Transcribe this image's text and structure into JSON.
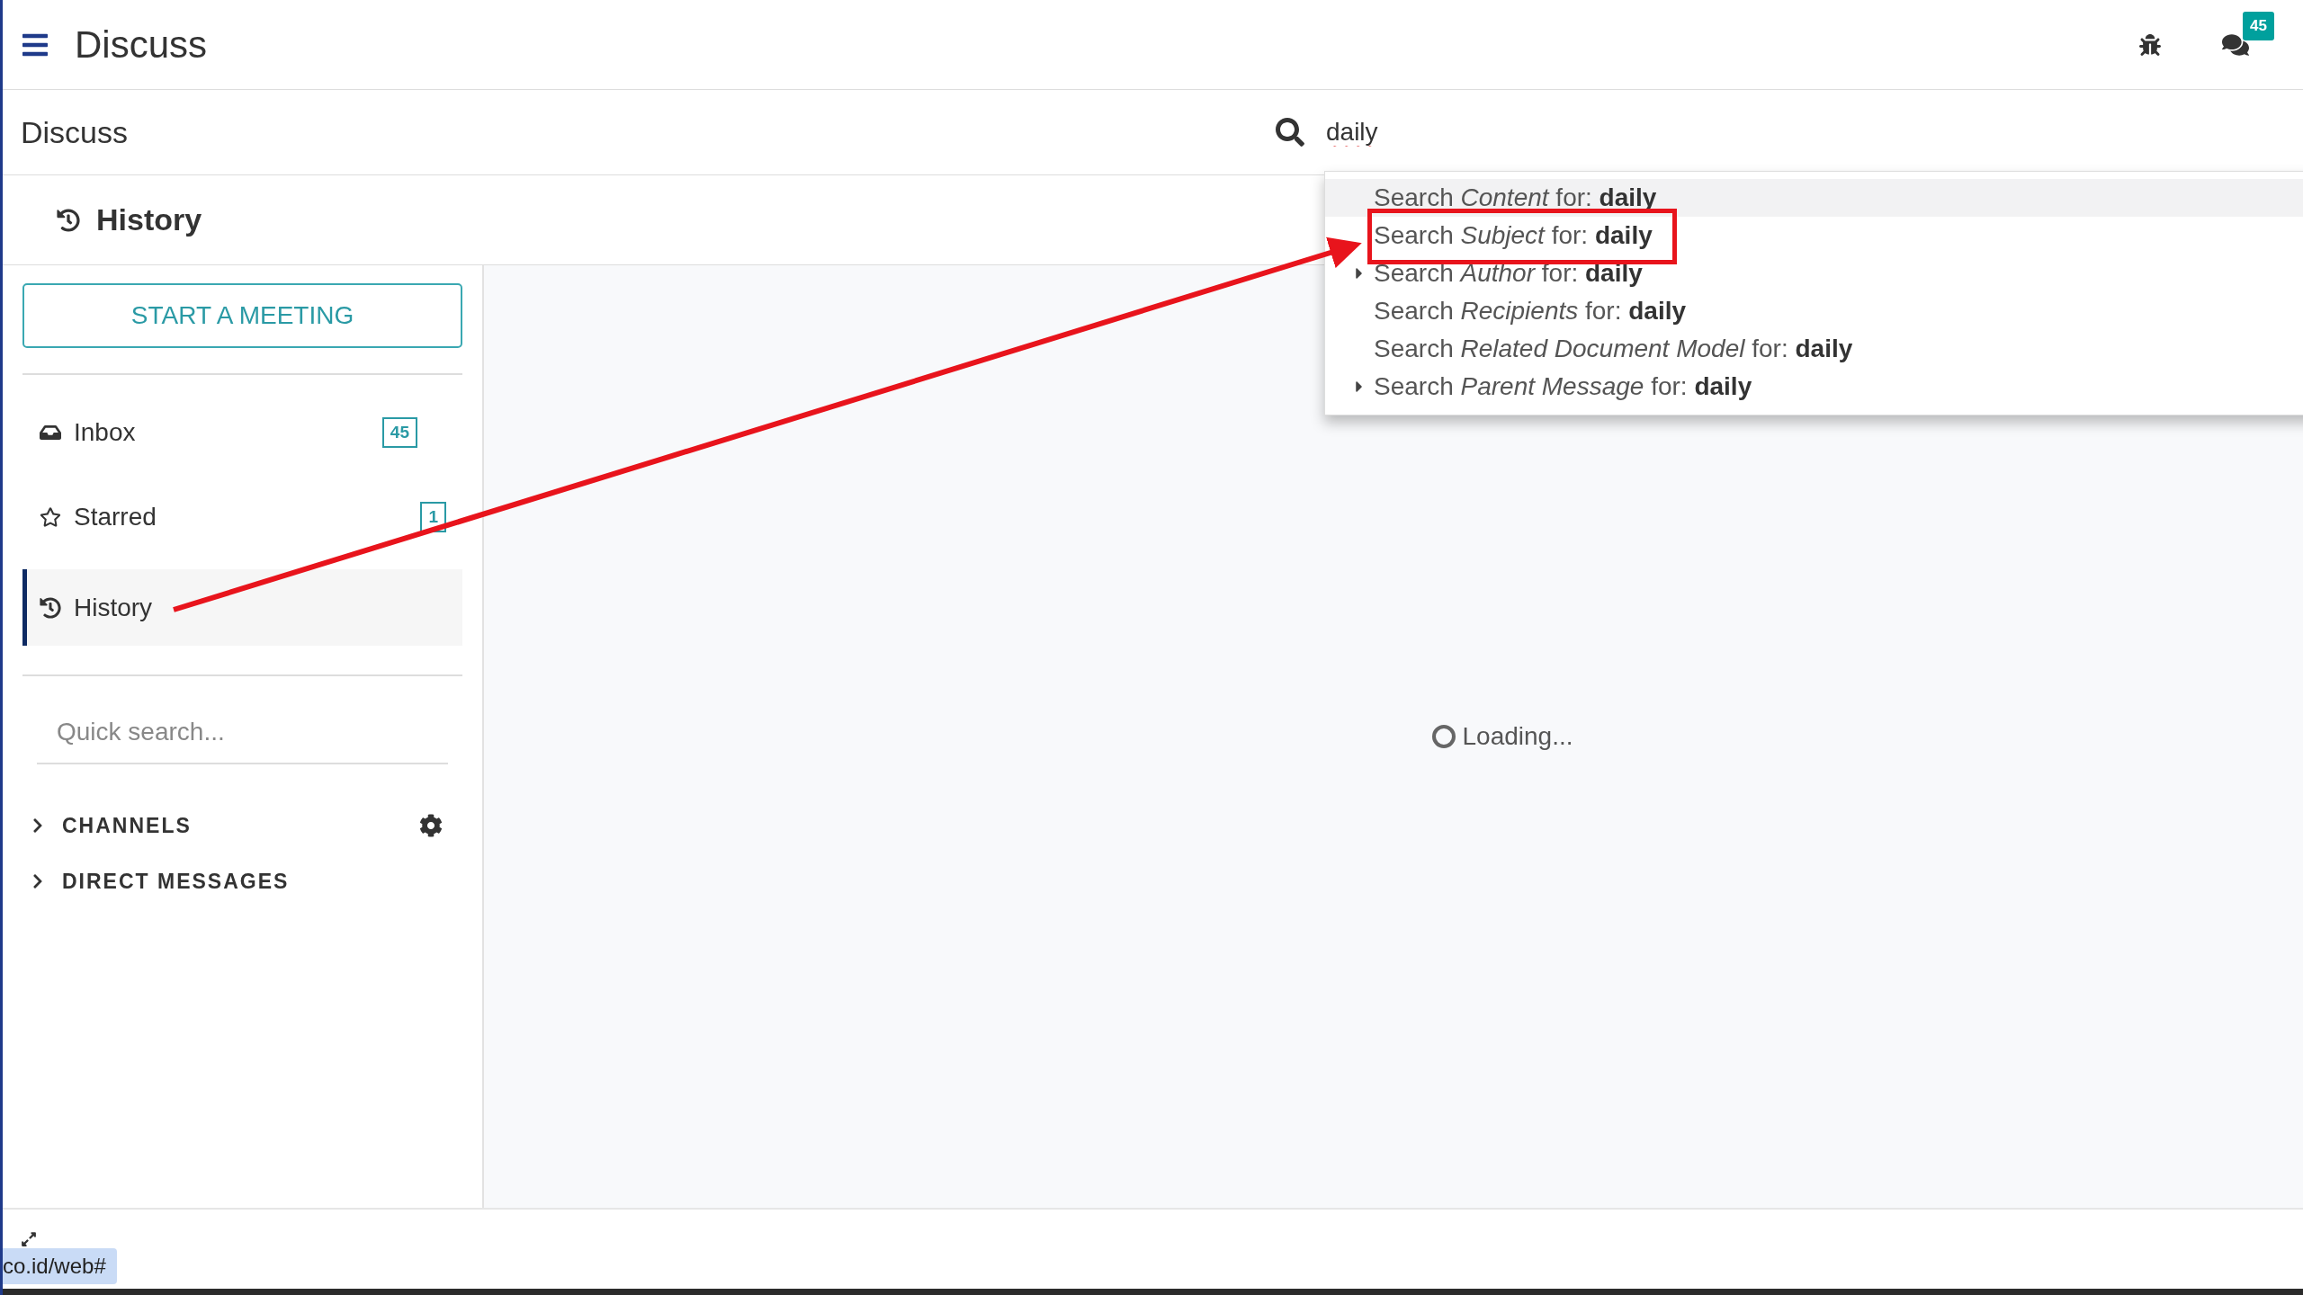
{
  "navbar": {
    "title": "Discuss",
    "messaging_counter": "45"
  },
  "control_panel": {
    "breadcrumb": "Discuss",
    "search": {
      "value": "daily"
    },
    "suggestions": [
      {
        "text": "Search *Content* for: **daily**",
        "expandable": false,
        "selected": true
      },
      {
        "text": "Search *Subject* for: **daily**",
        "expandable": false,
        "selected": false
      },
      {
        "text": "Search *Author* for: **daily**",
        "expandable": true,
        "selected": false
      },
      {
        "text": "Search *Recipients* for: **daily**",
        "expandable": false,
        "selected": false
      },
      {
        "text": "Search *Related Document Model* for: **daily**",
        "expandable": false,
        "selected": false
      },
      {
        "text": "Search *Parent Message* for: **daily**",
        "expandable": true,
        "selected": false
      }
    ]
  },
  "thread_header": {
    "title": "History"
  },
  "sidebar": {
    "start_button": "START A MEETING",
    "mailboxes": [
      {
        "kind": "inbox",
        "label": "Inbox",
        "counter": "45",
        "selected": false
      },
      {
        "kind": "starred",
        "label": "Starred",
        "counter": "1",
        "selected": false
      },
      {
        "kind": "history",
        "label": "History",
        "selected": true
      }
    ],
    "quick_search": {
      "placeholder": "Quick search..."
    },
    "categories": [
      {
        "label": "CHANNELS",
        "expanded": false,
        "settings": true
      },
      {
        "label": "DIRECT MESSAGES",
        "expanded": false,
        "settings": false
      }
    ]
  },
  "main": {
    "loading_text": "Loading..."
  },
  "status_url": "co.id/web#"
}
